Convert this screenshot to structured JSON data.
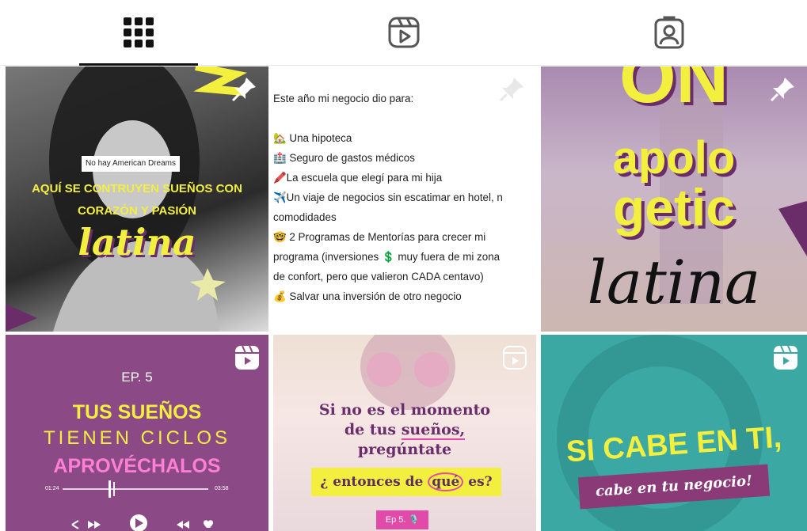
{
  "tabs": [
    {
      "name": "grid-icon",
      "active": true
    },
    {
      "name": "reels-icon",
      "active": false
    },
    {
      "name": "tagged-icon",
      "active": false
    }
  ],
  "posts": {
    "p1": {
      "tag": "No hay American Dreams",
      "line1": "AQUÍ SE CONTRUYEN SUEÑOS CON",
      "line2": "CORAZÓN Y PASIÓN",
      "word": "latina"
    },
    "p2": {
      "lines": [
        "Este  año mi negocio dio para:",
        "",
        "🏡 Una hipoteca",
        "🏥 Seguro de gastos médicos",
        "🖍️La escuela que elegí para mi hija",
        "✈️Un viaje de negocios sin escatimar en hotel, n",
        "comodidades",
        "🤓 2 Programas de Mentorías para crecer mi",
        "programa (inversiones  💲 muy fuera de mi zona",
        "de confort, pero que valieron CADA centavo)",
        "💰 Salvar una inversión de otro negocio"
      ]
    },
    "p3": {
      "top": "ON",
      "l1": "apolo",
      "l2": "getic",
      "word": "latina"
    },
    "p4": {
      "ep": "EP. 5",
      "l1": "TUS SUEÑOS",
      "l2": "TIENEN CICLOS",
      "l3": "APROVÉCHALOS",
      "t_start": "01:24",
      "t_end": "03:58"
    },
    "p5": {
      "l1": "Si no es el momento",
      "l2a": "de tus ",
      "l2b": "sueños,",
      "l3": "pregúntate",
      "q1": "¿ entonces de ",
      "q2": "qué",
      "q3": " es?",
      "ep": "Ep 5. 🎙️"
    },
    "p6": {
      "l1": "SI CABE EN TI,",
      "l2": "cabe en tu negocio!"
    }
  },
  "colors": {
    "purple": "#8b4a86",
    "yellow": "#f3ef3e",
    "pink": "#e24aa9",
    "teal": "#3ba8a3",
    "plum": "#5d2e5f"
  }
}
